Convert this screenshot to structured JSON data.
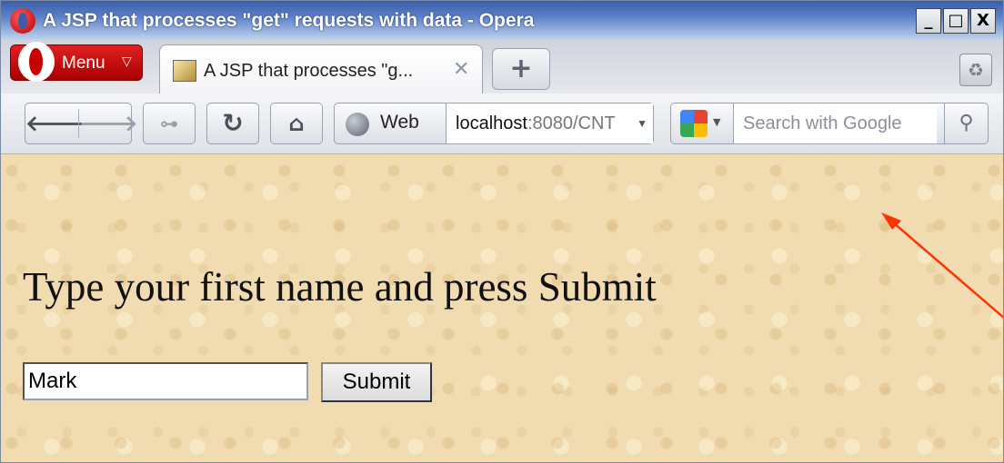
{
  "window": {
    "title": "A JSP that processes \"get\" requests with data - Opera",
    "controls": {
      "minimize": "_",
      "maximize": "□",
      "close": "X"
    }
  },
  "tabbar": {
    "menu_label": "Menu",
    "tabs": [
      {
        "label": "A JSP that processes \"g...",
        "close": "✕"
      }
    ],
    "new_tab": "+",
    "trash_icon": "trash-icon"
  },
  "toolbar": {
    "back": "back-arrow-icon",
    "forward": "forward-arrow-icon",
    "key": "key-icon",
    "reload": "reload-icon",
    "home": "home-icon",
    "web_label": "Web",
    "address": {
      "host": "localhost",
      "rest": ":8080/CNT"
    },
    "search_placeholder": "Search with Google"
  },
  "page": {
    "heading": "Type your first name and press Submit",
    "name_value": "Mark",
    "submit_label": "Submit"
  },
  "colors": {
    "titlebar": "#3a5ea8",
    "menu_red": "#c60000",
    "page_background": "#f1dcb1",
    "annotation_arrow": "#ff3300"
  }
}
